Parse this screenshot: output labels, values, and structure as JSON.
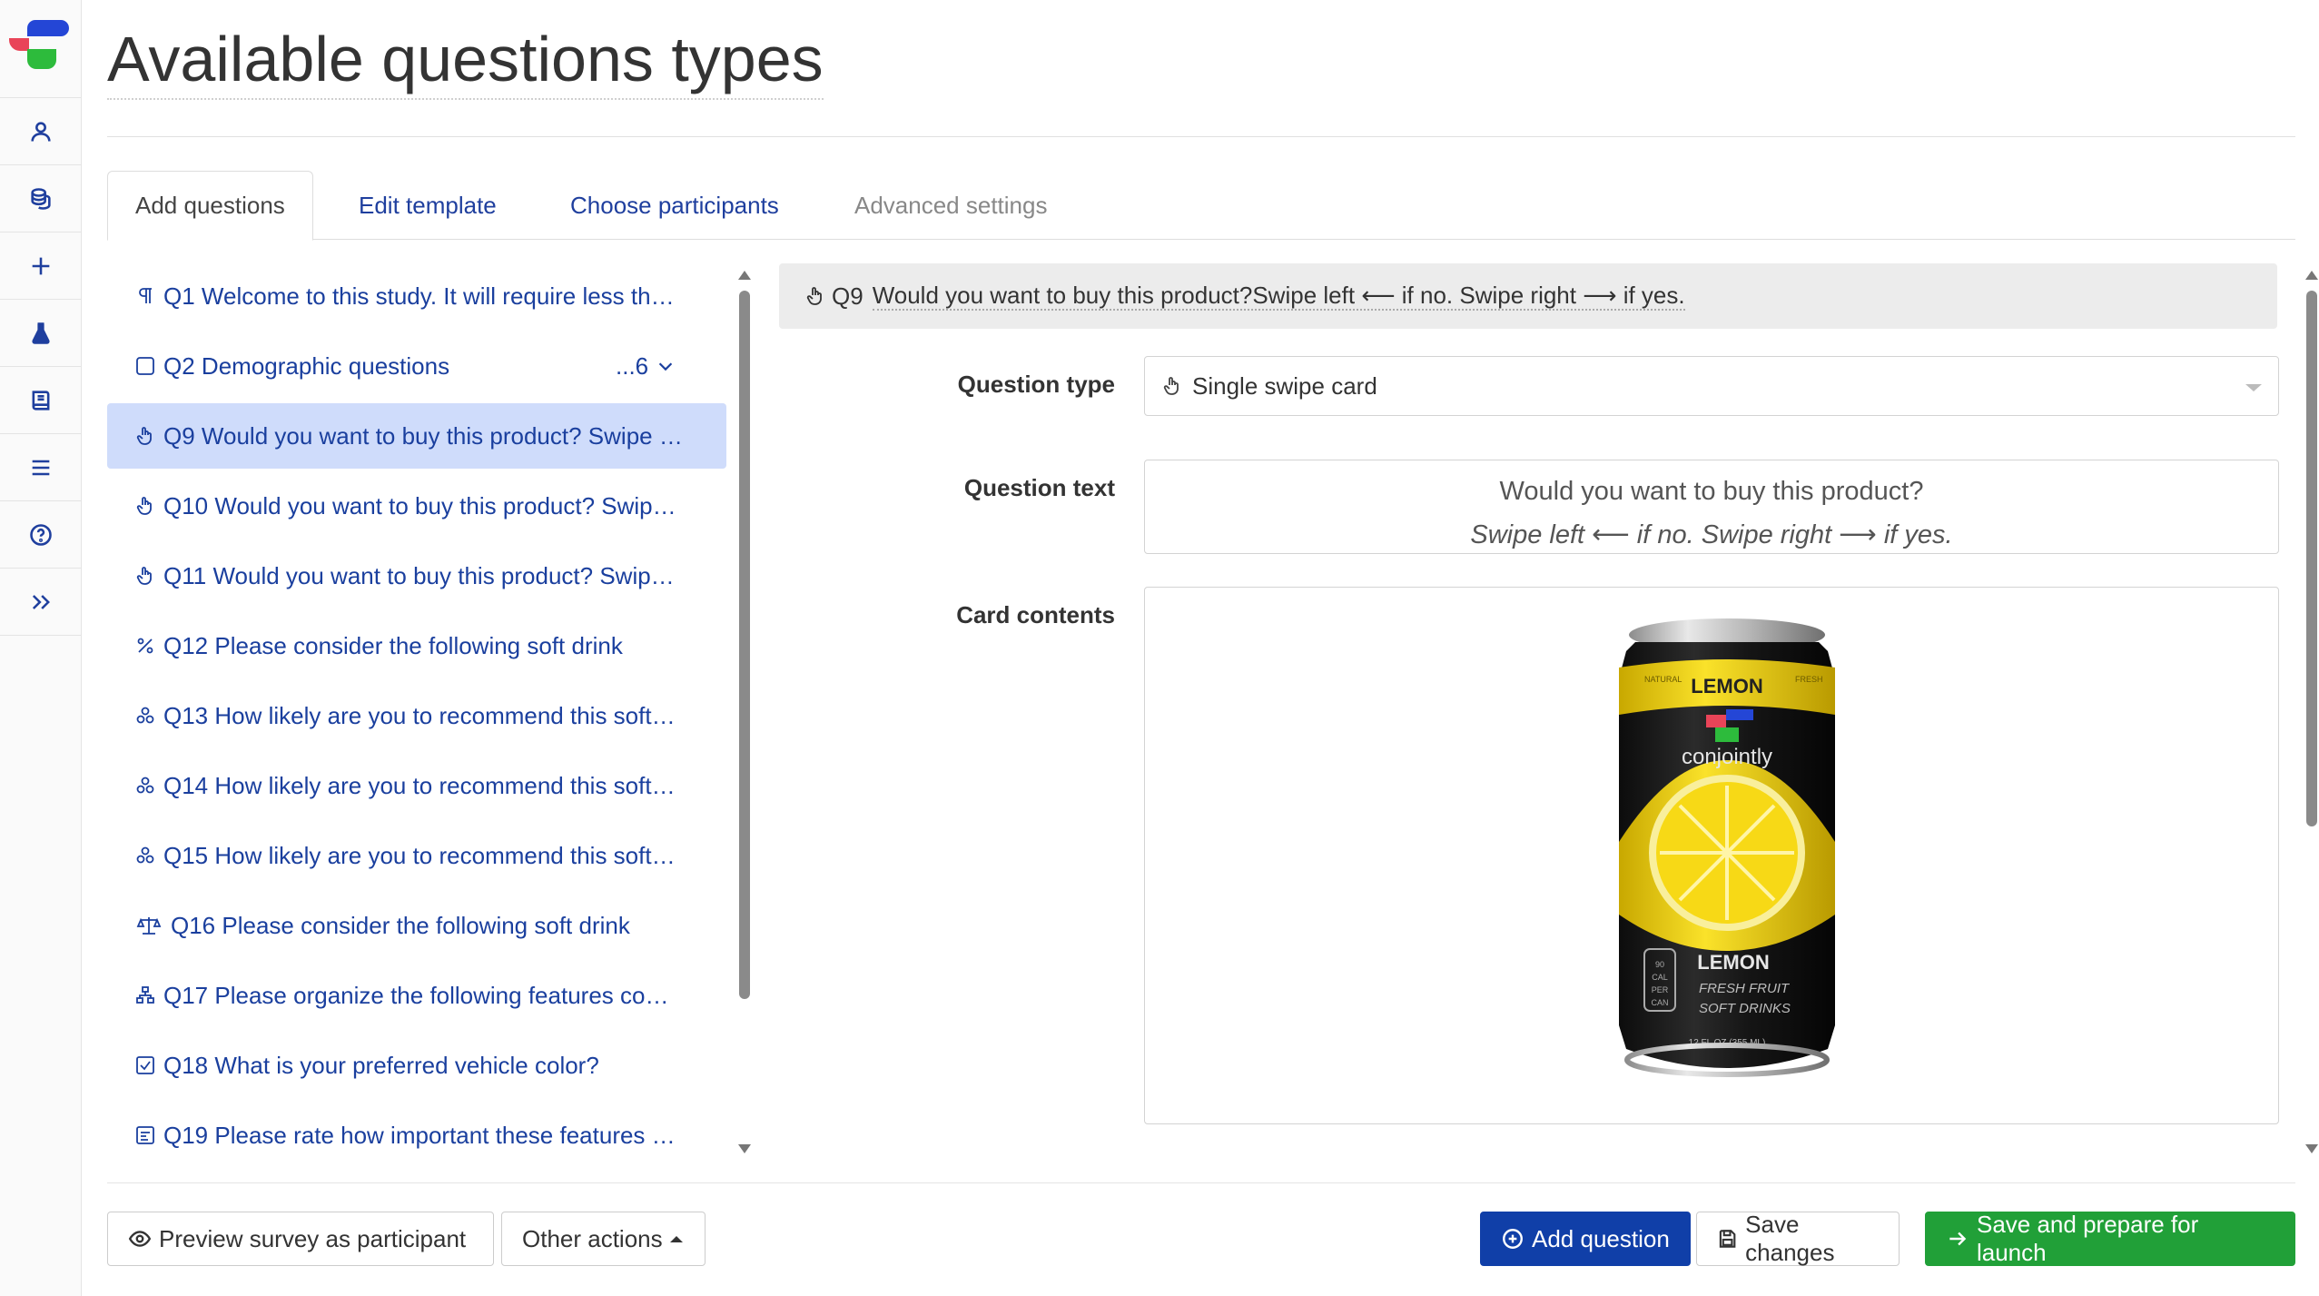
{
  "page": {
    "title": "Available questions types"
  },
  "tabs": [
    {
      "label": "Add questions"
    },
    {
      "label": "Edit template"
    },
    {
      "label": "Choose participants"
    },
    {
      "label": "Advanced settings"
    }
  ],
  "questions": [
    {
      "number": "Q1",
      "text": "Welcome to this study. It will require less th…",
      "icon": "paragraph-icon"
    },
    {
      "number": "Q2",
      "text": "Demographic questions",
      "icon": "checkbox-icon",
      "extra": "...6"
    },
    {
      "number": "Q9",
      "text": "Would you want to buy this product? Swipe …",
      "icon": "hand-pointer-icon",
      "selected": true
    },
    {
      "number": "Q10",
      "text": "Would you want to buy this product? Swip…",
      "icon": "hand-pointer-icon"
    },
    {
      "number": "Q11",
      "text": "Would you want to buy this product? Swip…",
      "icon": "hand-pointer-icon"
    },
    {
      "number": "Q12",
      "text": "Please consider the following soft drink",
      "icon": "percent-icon"
    },
    {
      "number": "Q13",
      "text": "How likely are you to recommend this soft…",
      "icon": "cubes-icon"
    },
    {
      "number": "Q14",
      "text": "How likely are you to recommend this soft…",
      "icon": "cubes-icon"
    },
    {
      "number": "Q15",
      "text": "How likely are you to recommend this soft…",
      "icon": "cubes-icon"
    },
    {
      "number": "Q16",
      "text": "Please consider the following soft drink",
      "icon": "balance-scale-icon"
    },
    {
      "number": "Q17",
      "text": "Please organize the following features co…",
      "icon": "sitemap-icon"
    },
    {
      "number": "Q18",
      "text": "What is your preferred vehicle color?",
      "icon": "check-square-icon"
    },
    {
      "number": "Q19",
      "text": "Please rate how important these features …",
      "icon": "list-box-icon"
    }
  ],
  "editor": {
    "header_number": "Q9",
    "header_title": "Would you want to buy this product?Swipe left ⟵ if no. Swipe right ⟶ if yes.",
    "question_type_label": "Question type",
    "question_type_value": "Single swipe card",
    "question_text_label": "Question text",
    "question_text_line1": "Would you want to buy this product?",
    "question_text_line2": "Swipe left ⟵ if no. Swipe right ⟶ if yes.",
    "card_contents_label": "Card contents",
    "can": {
      "top_label": "LEMON",
      "brand": "conjointly",
      "bottom_label": "LEMON",
      "tagline1": "FRESH FRUIT",
      "tagline2": "SOFT DRINKS",
      "volume": "12 FL OZ (355 ML)",
      "side_small": "NATURAL",
      "side_small2": "FRESH",
      "cal1": "90",
      "cal2": "CAL",
      "cal3": "PER",
      "cal4": "CAN"
    }
  },
  "footer": {
    "preview_label": "Preview survey as participant",
    "other_actions_label": "Other actions",
    "add_question_label": "Add question",
    "save_changes_label": "Save changes",
    "save_launch_label": "Save and prepare for launch"
  },
  "colors": {
    "link_blue": "#1a3f9e",
    "selected_bg": "#cfdcfb",
    "primary": "#103fa8",
    "success": "#21a038",
    "can_yellow": "#f2d300",
    "can_black": "#1b1b1b"
  }
}
